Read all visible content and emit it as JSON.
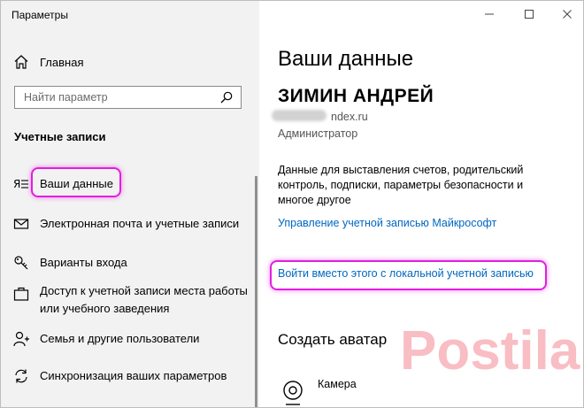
{
  "window": {
    "title": "Параметры",
    "controls": {
      "minimize": "—",
      "maximize": "☐",
      "close": "✕"
    }
  },
  "sidebar": {
    "home_label": "Главная",
    "search_placeholder": "Найти параметр",
    "section_title": "Учетные записи",
    "items": [
      {
        "label": "Ваши данные",
        "icon": "person-card-icon",
        "selected": true
      },
      {
        "label": "Электронная почта и учетные записи",
        "icon": "mail-icon"
      },
      {
        "label": "Варианты входа",
        "icon": "key-icon"
      },
      {
        "label": "Доступ к учетной записи места работы или учебного заведения",
        "icon": "briefcase-icon"
      },
      {
        "label": "Семья и другие пользователи",
        "icon": "person-add-icon"
      },
      {
        "label": "Синхронизация ваших параметров",
        "icon": "sync-icon"
      }
    ]
  },
  "main": {
    "heading": "Ваши данные",
    "user_name": "ЗИМИН АНДРЕЙ",
    "email": "ndex.ru",
    "role": "Администратор",
    "description": "Данные для выставления счетов, родительский контроль, подписки, параметры безопасности и многое другое",
    "manage_link": "Управление учетной записью Майкрософт",
    "local_account_link": "Войти вместо этого с локальной учетной записью",
    "avatar_heading": "Создать аватар",
    "camera_label": "Камера"
  },
  "colors": {
    "sidebar_bg": "#f2f2f2",
    "link": "#0067c0",
    "highlight": "#e21ee0",
    "watermark": "#eb3246"
  },
  "watermark_text": "Postila"
}
